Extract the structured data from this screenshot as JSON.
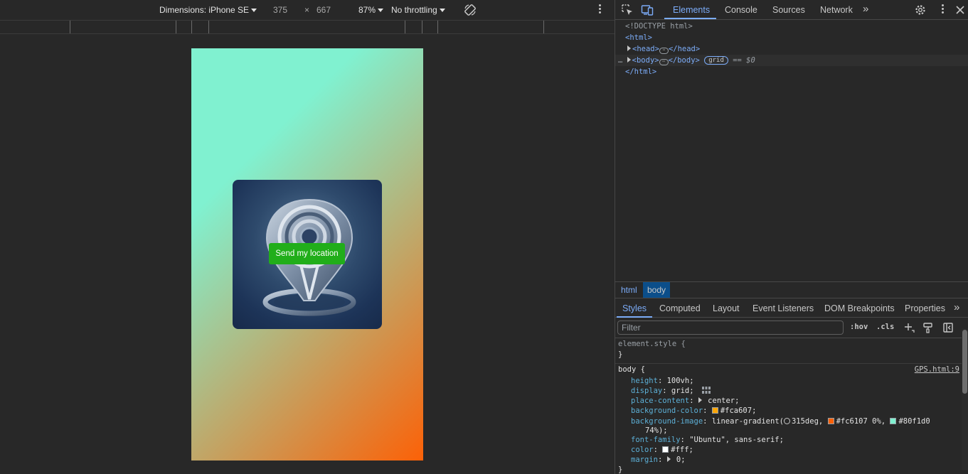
{
  "device_toolbar": {
    "dimensions_label": "Dimensions: iPhone SE",
    "width": "375",
    "times": "×",
    "height": "667",
    "zoom": "87%",
    "throttling": "No throttling"
  },
  "page": {
    "button_label": "Send my location",
    "gradient_from": "#fc6107",
    "gradient_to": "#80f1d0",
    "button_color": "#21ae1a"
  },
  "devtools": {
    "tabs": [
      "Elements",
      "Console",
      "Sources",
      "Network"
    ],
    "more": "»",
    "dom": {
      "doctype": "<!DOCTYPE html>",
      "html_open": "<html>",
      "head_open": "<head>",
      "head_close": "</head>",
      "body_open": "<body>",
      "body_close": "</body>",
      "grid_badge": "grid",
      "selected_marker": "== $0",
      "html_close": "</html>",
      "ellipsis": "⋯",
      "row_dots": "…"
    },
    "breadcrumbs": [
      "html",
      "body"
    ],
    "sub_tabs": [
      "Styles",
      "Computed",
      "Layout",
      "Event Listeners",
      "DOM Breakpoints",
      "Properties"
    ],
    "filter_placeholder": "Filter",
    "hov": ":hov",
    "cls": ".cls",
    "styles": {
      "element_style": "element.style {",
      "close_brace": "}",
      "body_selector": "body {",
      "source": "GPS.html:9",
      "declarations": [
        {
          "prop": "height",
          "value": "100vh;"
        },
        {
          "prop": "display",
          "value": "grid;"
        },
        {
          "prop": "place-content",
          "value": "center;"
        },
        {
          "prop": "background-color",
          "value": "#fca607;"
        },
        {
          "prop": "background-image",
          "value": "linear-gradient("
        },
        {
          "prop": "font-family",
          "value": "\"Ubuntu\", sans-serif;"
        },
        {
          "prop": "color",
          "value": "#fff;"
        },
        {
          "prop": "margin",
          "value": "0;"
        }
      ],
      "gradient_angle": "315deg,",
      "gradient_stop1": "#fc6107 0%,",
      "gradient_stop2": "#80f1d0",
      "gradient_tail": "74%);",
      "swatch_colors": {
        "bg": "#fca607",
        "stop1": "#fc6107",
        "stop2": "#80f1d0",
        "color": "#ffffff"
      }
    }
  }
}
